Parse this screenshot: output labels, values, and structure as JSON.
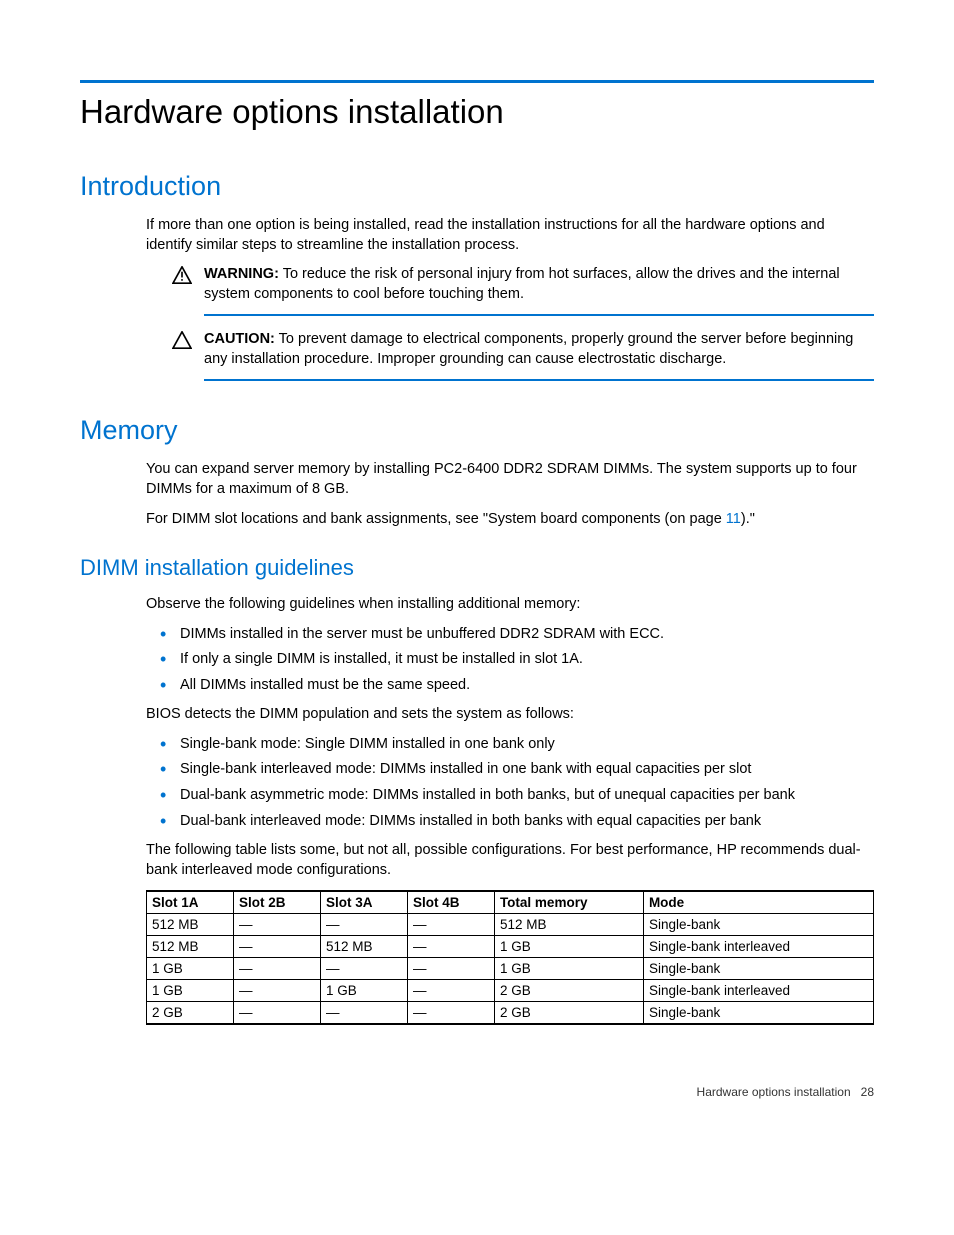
{
  "title": "Hardware options installation",
  "sections": {
    "introduction": {
      "heading": "Introduction",
      "body": "If more than one option is being installed, read the installation instructions for all the hardware options and identify similar steps to streamline the installation process.",
      "warning_label": "WARNING:",
      "warning_text": "  To reduce the risk of personal injury from hot surfaces, allow the drives and the internal system components to cool before touching them.",
      "caution_label": "CAUTION:",
      "caution_text": "  To prevent damage to electrical components, properly ground the server before beginning any installation procedure. Improper grounding can cause electrostatic discharge."
    },
    "memory": {
      "heading": "Memory",
      "p1": "You can expand server memory by installing PC2-6400 DDR2 SDRAM DIMMs. The system supports up to four DIMMs for a maximum of 8 GB.",
      "p2a": "For DIMM slot locations and bank assignments, see \"System board components (on page ",
      "p2_link": "11",
      "p2b": ").\""
    },
    "dimm": {
      "heading": "DIMM installation guidelines",
      "intro": "Observe the following guidelines when installing additional memory:",
      "bullets1": [
        "DIMMs installed in the server must be unbuffered DDR2 SDRAM with ECC.",
        "If only a single DIMM is installed, it must be installed in slot 1A.",
        "All DIMMs installed must be the same speed."
      ],
      "mid": "BIOS detects the DIMM population and sets the system as follows:",
      "bullets2": [
        "Single-bank mode: Single DIMM installed in one bank only",
        "Single-bank interleaved mode: DIMMs installed in one bank with equal capacities per slot",
        "Dual-bank asymmetric mode: DIMMs installed in both banks, but of unequal capacities per bank",
        "Dual-bank interleaved mode: DIMMs installed in both banks with equal capacities per bank"
      ],
      "table_intro": "The following table lists some, but not all, possible configurations. For best performance, HP recommends dual-bank interleaved mode configurations.",
      "table": {
        "headers": [
          "Slot 1A",
          "Slot 2B",
          "Slot 3A",
          "Slot 4B",
          "Total memory",
          "Mode"
        ],
        "rows": [
          [
            "512 MB",
            "—",
            "—",
            "—",
            "512 MB",
            "Single-bank"
          ],
          [
            "512 MB",
            "—",
            "512 MB",
            "—",
            "1 GB",
            "Single-bank interleaved"
          ],
          [
            "1 GB",
            "—",
            "—",
            "—",
            "1 GB",
            "Single-bank"
          ],
          [
            "1 GB",
            "—",
            "1 GB",
            "—",
            "2 GB",
            "Single-bank interleaved"
          ],
          [
            "2 GB",
            "—",
            "—",
            "—",
            "2 GB",
            "Single-bank"
          ]
        ]
      }
    }
  },
  "footer": {
    "text": "Hardware options installation",
    "page": "28"
  }
}
